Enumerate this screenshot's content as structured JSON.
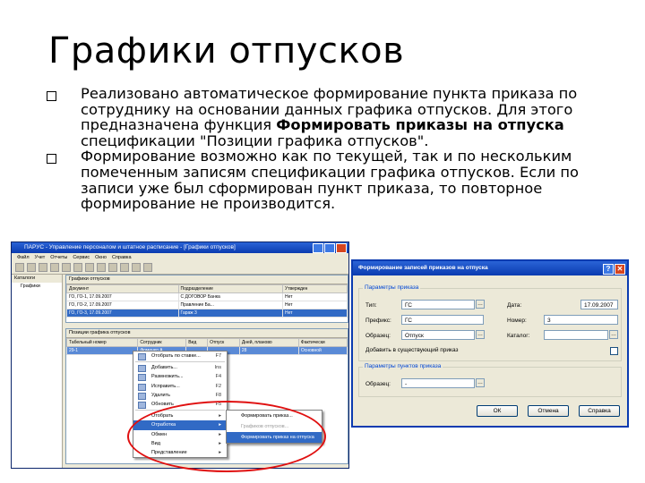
{
  "slide": {
    "title": "Графики отпусков",
    "bullet1_pre": "Реализовано автоматическое формирование пункта приказа по сотруднику на основании данных графика отпусков. Для этого предназначена функция ",
    "bullet1_bold": "Формировать приказы на отпуска",
    "bullet1_post": " спецификации \"Позиции графика отпусков\".",
    "bullet2": "Формирование возможно как по текущей, так и по нескольким помеченным записям спецификации графика отпусков. Если по записи уже был сформирован пункт приказа, то повторное формирование не производится."
  },
  "main_window": {
    "title": "ПАРУС - Управление персоналом и штатное расписание - [Графики отпусков]",
    "menu": [
      "Файл",
      "Учет",
      "Отчеты",
      "Сервис",
      "Окно",
      "Справка"
    ],
    "catalog_header": "Каталоги",
    "catalog_item": "Графики",
    "top_grid": {
      "caption": "Графики отпусков",
      "columns": [
        "Документ",
        "Подразделение",
        "Утвержден"
      ],
      "rows": [
        [
          "ГО, ГО-1, 17.09.2007",
          "С ДОГОВОР Банка",
          "Нет"
        ],
        [
          "ГО, ГО-2, 17.09.2007",
          "Правление Ба...",
          "Нет"
        ],
        [
          "ГО, ГО-3, 17.09.2007",
          "Гараж 3",
          "Нет"
        ]
      ]
    },
    "bottom_grid": {
      "caption": "Позиции графика отпусков",
      "columns": [
        "Табельный номер",
        "Сотрудник",
        "Вид",
        "Отпуск",
        "Дней, планово",
        "Фактически"
      ],
      "rows": [
        [
          "29-1",
          "Фоменко А.",
          "",
          "",
          "28",
          "Основной"
        ]
      ]
    }
  },
  "context_menu": {
    "items": [
      {
        "label": "Отобрать по ставке...",
        "key": "F7"
      },
      {
        "label": "Добавить...",
        "key": "Ins"
      },
      {
        "label": "Размножить...",
        "key": "F4"
      },
      {
        "label": "Исправить...",
        "key": "F2"
      },
      {
        "label": "Удалить",
        "key": "F8"
      },
      {
        "label": "Обновить",
        "key": "F5"
      },
      {
        "label": "Отобрать",
        "key": ""
      },
      {
        "label": "Отработка",
        "key": ""
      },
      {
        "label": "Обмен",
        "key": ""
      },
      {
        "label": "Вид",
        "key": ""
      },
      {
        "label": "Представление",
        "key": ""
      }
    ],
    "submenu": [
      {
        "label": "Формировать приказ...",
        "state": "normal"
      },
      {
        "label": "Графиков отпусков...",
        "state": "dim"
      },
      {
        "label": "Формировать приказ на отпуска",
        "state": "highlight"
      }
    ]
  },
  "dialog": {
    "title": "Формирование записей приказов на отпуска",
    "group1": "Параметры приказа",
    "type_label": "Тип:",
    "type_value": "ГС",
    "date_label": "Дата:",
    "date_value": "17.09.2007",
    "prefix_label": "Префикс:",
    "prefix_value": "ГС",
    "number_label": "Номер:",
    "number_value": "3",
    "sample_label": "Образец:",
    "sample_value": "Отпуск",
    "catalog_label": "Каталог:",
    "add_existing_label": "Добавить в существующий приказ",
    "group2": "Параметры пунктов приказа",
    "sample2_label": "Образец:",
    "sample2_value": "-",
    "ok": "ОК",
    "cancel": "Отмена",
    "help": "Справка"
  }
}
